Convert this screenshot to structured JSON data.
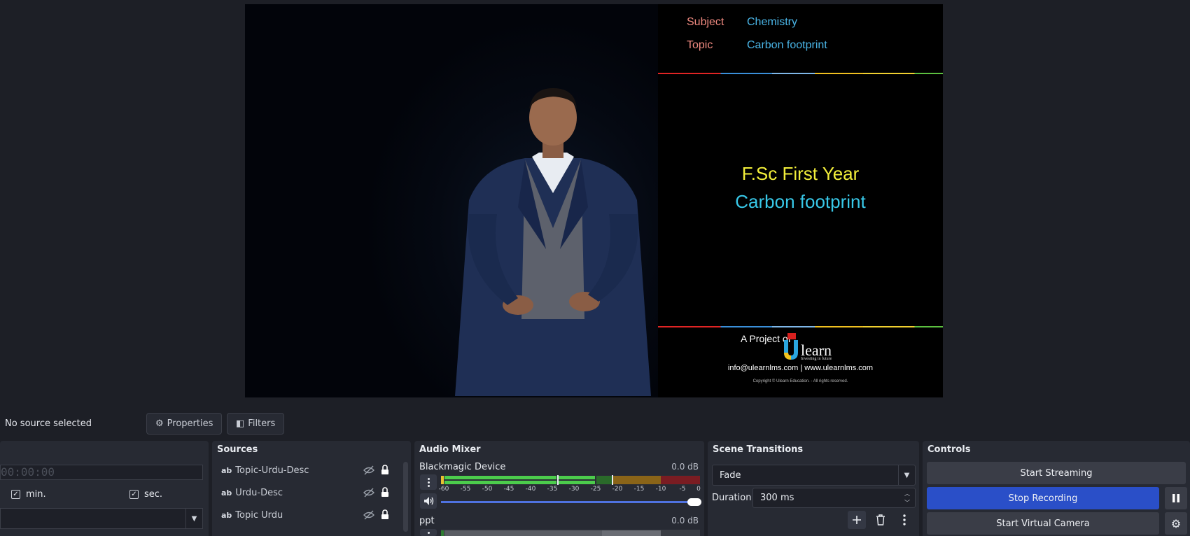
{
  "preview": {
    "subject_label": "Subject",
    "subject_value": "Chemistry",
    "topic_label": "Topic",
    "topic_value": "Carbon footprint",
    "title_line1": "F.Sc First Year",
    "title_line2": "Carbon footprint",
    "project_of": "A Project of",
    "logo_text": "learn",
    "logo_tagline": "Investing in future",
    "contact": "info@ulearnlms.com | www.ulearnlms.com",
    "copyright": "Copyright © Ulearn Education. - All rights reserved."
  },
  "toolbar": {
    "status": "No source selected",
    "properties_label": "Properties",
    "filters_label": "Filters"
  },
  "timer": {
    "display": "00:00:00",
    "min_label": "min.",
    "sec_label": "sec."
  },
  "sources": {
    "title": "Sources",
    "items": [
      {
        "type_icon": "ab",
        "label": "Topic-Urdu-Desc"
      },
      {
        "type_icon": "ab",
        "label": "Urdu-Desc"
      },
      {
        "type_icon": "ab",
        "label": "Topic Urdu"
      }
    ]
  },
  "mixer": {
    "title": "Audio Mixer",
    "channels": [
      {
        "name": "Blackmagic Device",
        "db": "0.0 dB",
        "volume_fraction": 1.0
      },
      {
        "name": "ppt",
        "db": "0.0 dB"
      }
    ],
    "ticks": [
      "-60",
      "-55",
      "-50",
      "-45",
      "-40",
      "-35",
      "-30",
      "-25",
      "-20",
      "-15",
      "-10",
      "-5",
      "0"
    ]
  },
  "transitions": {
    "title": "Scene Transitions",
    "selected": "Fade",
    "duration_label": "Duration",
    "duration_value": "300 ms"
  },
  "controls": {
    "title": "Controls",
    "start_streaming": "Start Streaming",
    "stop_recording": "Stop Recording",
    "start_virtual_camera": "Start Virtual Camera"
  },
  "colors": {
    "accent": "#2a4fc8",
    "panel": "#272a33",
    "background": "#1d1f26"
  }
}
